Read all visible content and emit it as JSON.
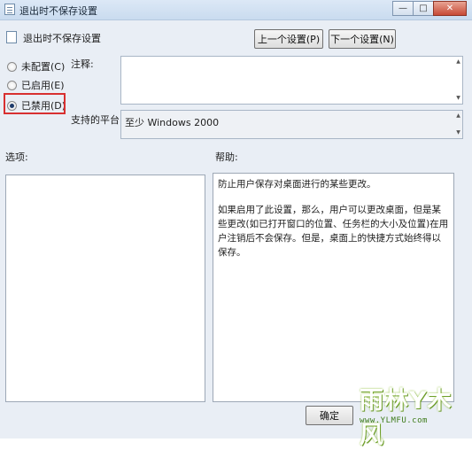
{
  "window": {
    "title": "退出时不保存设置"
  },
  "header": {
    "title": "退出时不保存设置",
    "prev_button": "上一个设置(P)",
    "next_button": "下一个设置(N)"
  },
  "options": {
    "not_configured": "未配置(C)",
    "enabled": "已启用(E)",
    "disabled": "已禁用(D)",
    "selected": "disabled"
  },
  "fields": {
    "comment_label": "注释:",
    "comment_value": "",
    "platform_label": "支持的平台:",
    "platform_value": "至少 Windows 2000"
  },
  "sections": {
    "options_label": "选项:",
    "help_label": "帮助:"
  },
  "help": {
    "paragraph1": "防止用户保存对桌面进行的某些更改。",
    "paragraph2": "如果启用了此设置，那么，用户可以更改桌面，但是某些更改(如已打开窗口的位置、任务栏的大小及位置)在用户注销后不会保存。但是，桌面上的快捷方式始终得以保存。"
  },
  "footer": {
    "ok_button": "确定"
  },
  "watermark": {
    "main": "雨林Y木风",
    "url": "www.YLMFU.com"
  }
}
